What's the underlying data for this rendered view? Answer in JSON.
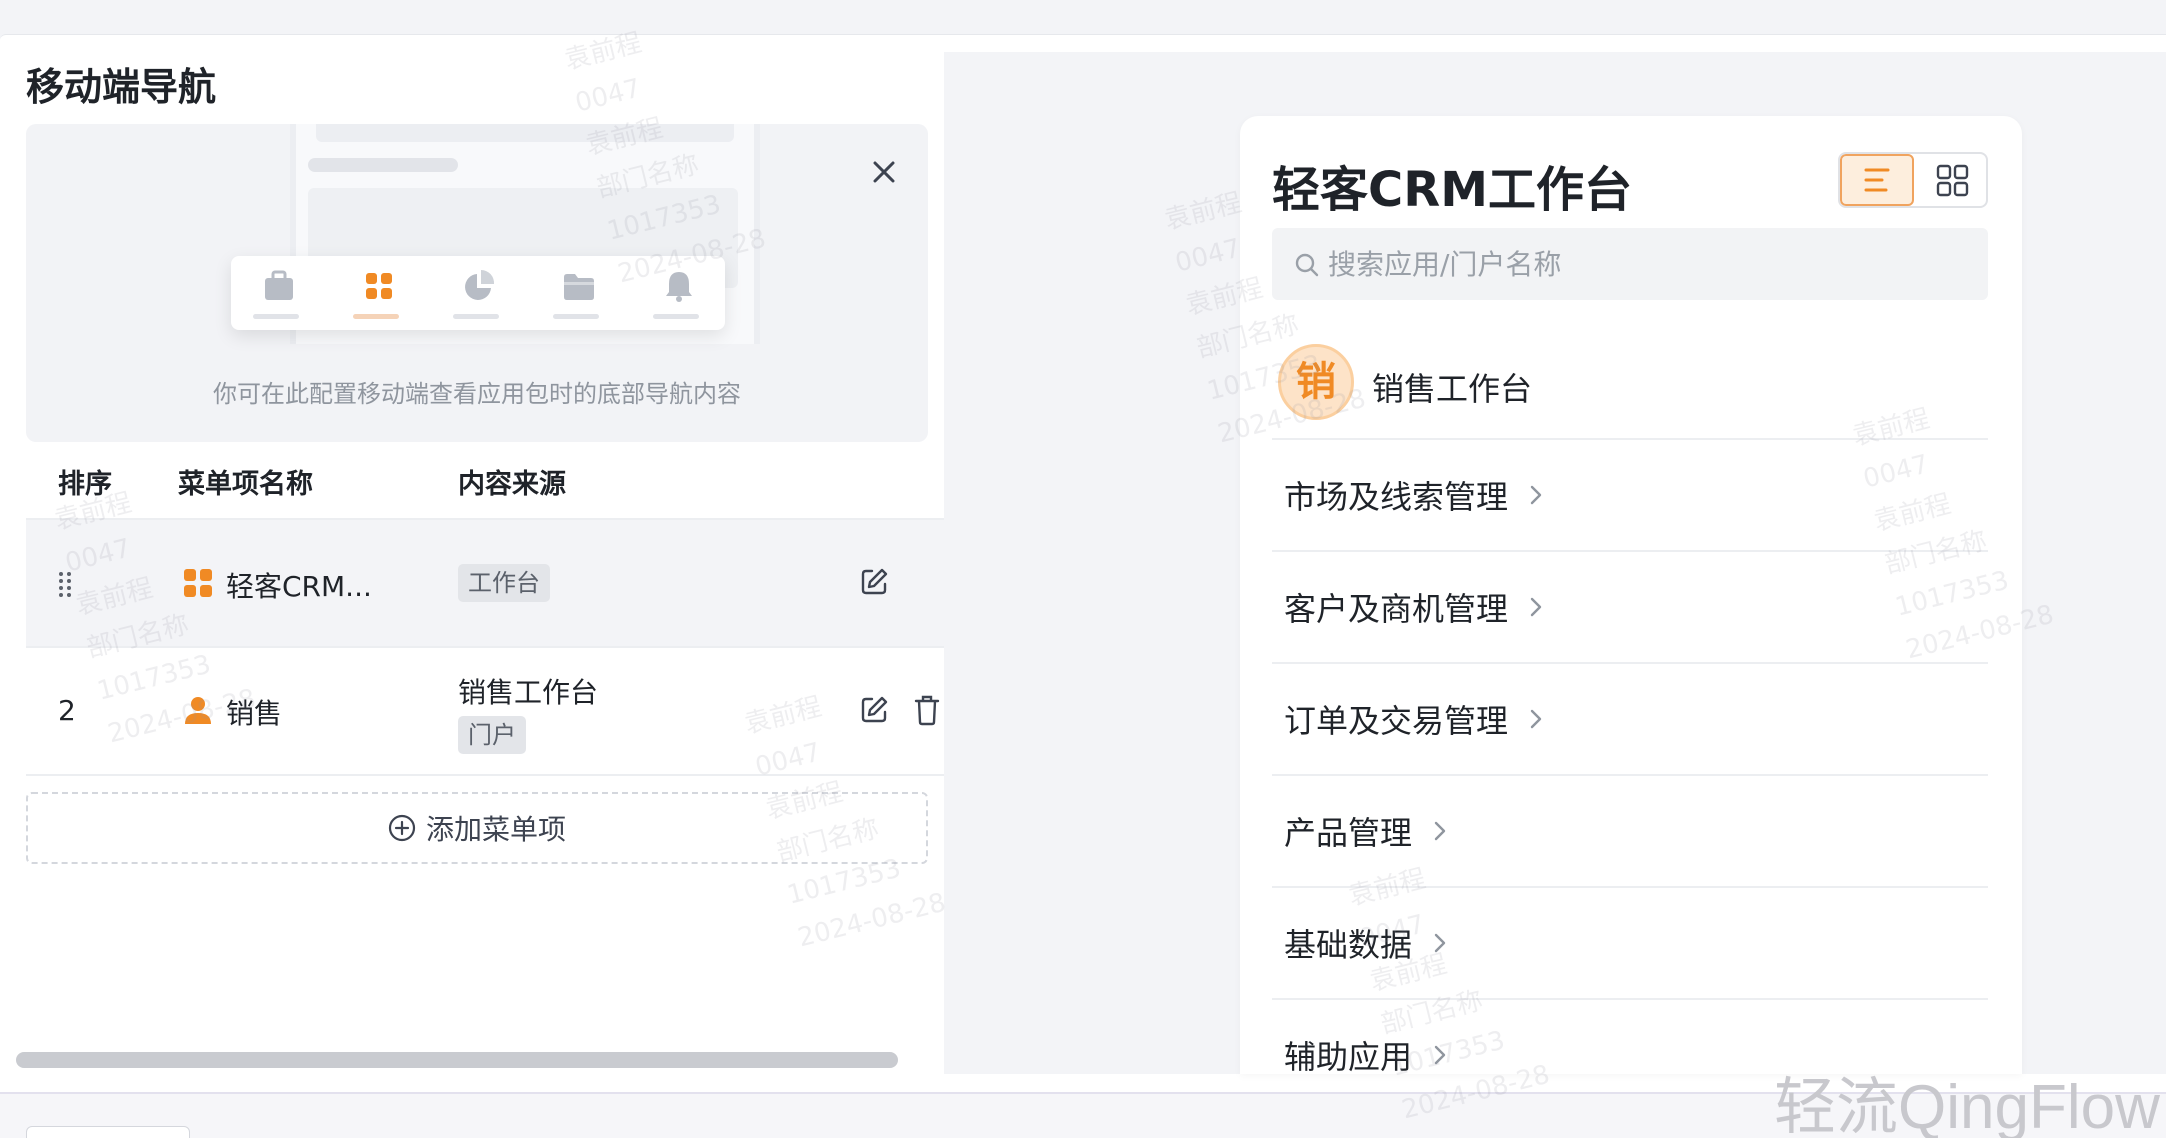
{
  "section": {
    "title": "移动端导航",
    "preview_caption": "你可在此配置移动端查看应用包时的底部导航内容",
    "nav_icons": [
      "briefcase-icon",
      "apps-grid-icon",
      "pie-chart-icon",
      "folder-icon",
      "bell-icon"
    ],
    "active_nav_index": 1
  },
  "table": {
    "headers": {
      "order": "排序",
      "name": "菜单项名称",
      "source": "内容来源"
    },
    "rows": [
      {
        "order": "",
        "name": "轻客CRM...",
        "icon": "apps-grid-icon",
        "source_title": "",
        "source_tag": "工作台"
      },
      {
        "order": "2",
        "name": "销售",
        "icon": "user-icon",
        "source_title": "销售工作台",
        "source_tag": "门户"
      }
    ],
    "add_label": "添加菜单项"
  },
  "mobile": {
    "app_title": "轻客CRM工作台",
    "search_placeholder": "搜索应用/门户名称",
    "portal": {
      "avatar_text": "销",
      "name": "销售工作台"
    },
    "menu_items": [
      "市场及线索管理",
      "客户及商机管理",
      "订单及交易管理",
      "产品管理",
      "基础数据",
      "辅助应用"
    ]
  },
  "watermark": {
    "lines": [
      "袁前程",
      "0047",
      "袁前程",
      "部门名称",
      "1017353",
      "2024-08-28"
    ]
  },
  "brand": "轻流QingFlow",
  "colors": {
    "accent": "#f08a24",
    "accent_light": "#fdeedd",
    "text_primary": "#1f2329",
    "text_secondary": "#8f959e"
  }
}
